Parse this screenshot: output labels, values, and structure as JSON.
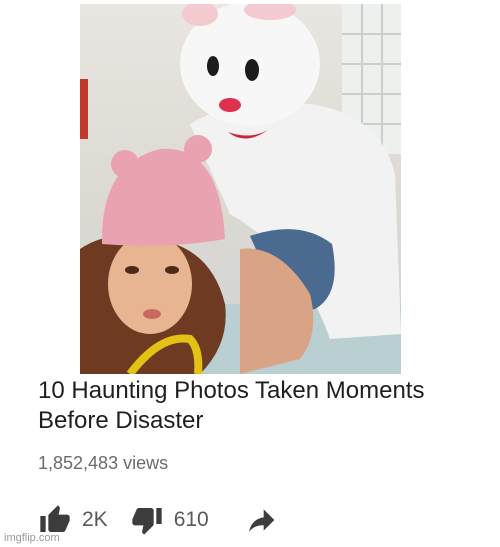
{
  "video": {
    "title": "10 Haunting Photos Taken Moments Before Disaster",
    "views": "1,852,483 views"
  },
  "actions": {
    "likes": "2K",
    "dislikes": "610"
  },
  "icons": {
    "like": "thumbs-up-icon",
    "dislike": "thumbs-down-icon",
    "share": "share-arrow-icon"
  },
  "watermark": "imgflip.com",
  "colors": {
    "text": "#1f1f1f",
    "muted": "#6b6b6b",
    "icon": "#3c3c3c"
  }
}
